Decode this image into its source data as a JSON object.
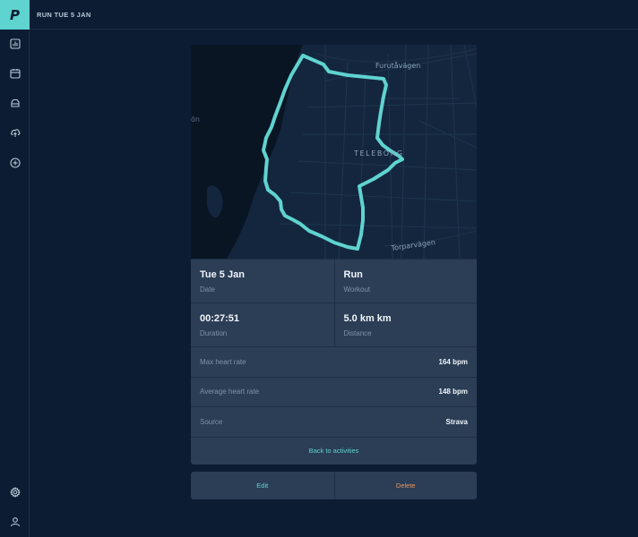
{
  "app": {
    "logo_letter": "P"
  },
  "header": {
    "title": "RUN TUE 5 JAN"
  },
  "sidebar": {
    "top_items": [
      {
        "icon": "bar-chart-icon"
      },
      {
        "icon": "calendar-icon"
      },
      {
        "icon": "shoe-icon"
      },
      {
        "icon": "cloud-upload-icon"
      },
      {
        "icon": "plus-circle-icon"
      }
    ],
    "bottom_items": [
      {
        "icon": "gear-icon"
      },
      {
        "icon": "user-icon"
      }
    ]
  },
  "map": {
    "labels": {
      "north_street": "Furutåvägen",
      "district": "TELEBORG",
      "south_street": "Torparvägen",
      "lake_fragment": "ön"
    },
    "route_color": "#5fd3cf"
  },
  "activity": {
    "date": {
      "value": "Tue 5 Jan",
      "label": "Date"
    },
    "workout": {
      "value": "Run",
      "label": "Workout"
    },
    "duration": {
      "value": "00:27:51",
      "label": "Duration"
    },
    "distance": {
      "value": "5.0 km km",
      "label": "Distance"
    },
    "max_hr": {
      "label": "Max heart rate",
      "value": "164 bpm"
    },
    "avg_hr": {
      "label": "Average heart rate",
      "value": "148 bpm"
    },
    "source": {
      "label": "Source",
      "value": "Strava"
    },
    "back_label": "Back to activities"
  },
  "actions": {
    "edit": "Edit",
    "delete": "Delete"
  },
  "colors": {
    "accent": "#5fd3cf",
    "danger": "#e8955a",
    "background": "#0c1d33",
    "card": "#2b3e56"
  }
}
